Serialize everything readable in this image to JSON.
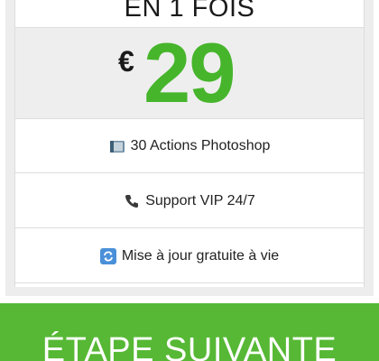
{
  "plan": {
    "title": "EN 1 FOIS",
    "currency": "€",
    "price": "29"
  },
  "features": [
    {
      "icon": "book-icon",
      "label": "30 Actions Photoshop"
    },
    {
      "icon": "phone-icon",
      "label": "Support VIP 24/7"
    },
    {
      "icon": "refresh-icon",
      "label": "Mise à jour gratuite à vie"
    }
  ],
  "cta": {
    "label": "ÉTAPE SUIVANTE"
  },
  "colors": {
    "price_green": "#46b52b",
    "cta_green": "#56b834",
    "frame_gray": "#ededed"
  }
}
